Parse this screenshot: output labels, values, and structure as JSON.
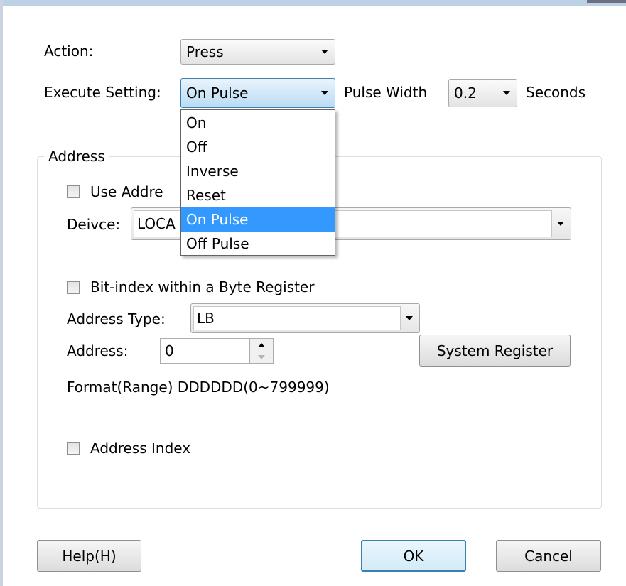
{
  "action": {
    "label": "Action:",
    "value": "Press"
  },
  "execute": {
    "label": "Execute Setting:",
    "value": "On Pulse"
  },
  "pulse": {
    "label": "Pulse Width",
    "value": "0.2",
    "unit": "Seconds"
  },
  "execute_options": [
    "On",
    "Off",
    "Inverse",
    "Reset",
    "On Pulse",
    "Off Pulse"
  ],
  "execute_selected_index": 4,
  "address_group": {
    "title": "Address",
    "use_address_label": "Use Addre",
    "device_label": "Deivce:",
    "device_value": "LOCA",
    "bit_index_label": "Bit-index within a Byte Register",
    "address_type_label": "Address Type:",
    "address_type_value": "LB",
    "address_label": "Address:",
    "address_value": "0",
    "system_register_label": "System Register",
    "format_text": "Format(Range) DDDDDD(0~799999)",
    "address_index_label": "Address Index"
  },
  "buttons": {
    "help": "Help(H)",
    "ok": "OK",
    "cancel": "Cancel"
  },
  "colors": {
    "selection": "#3399ff",
    "accent_border": "#3c7fb1"
  }
}
